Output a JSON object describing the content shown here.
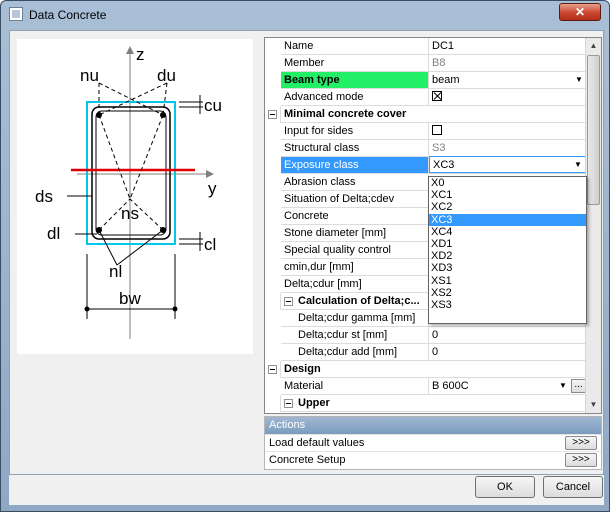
{
  "window": {
    "title": "Data Concrete",
    "close_label": "✕"
  },
  "diagram": {
    "labels": {
      "z": "z",
      "nu": "nu",
      "du": "du",
      "cu": "cu",
      "y": "y",
      "ds": "ds",
      "ns": "ns",
      "dl": "dl",
      "cl": "cl",
      "nl": "nl",
      "bw": "bw"
    },
    "colors": {
      "stirrup": "#00c8e8",
      "axis": "#808080",
      "neutral_line": "#e00000"
    }
  },
  "properties": [
    {
      "label": "Name",
      "value": "DC1",
      "kind": "text"
    },
    {
      "label": "Member",
      "value": "B8",
      "kind": "text",
      "gray": true
    },
    {
      "label": "Beam type",
      "value": "beam",
      "kind": "combo",
      "highlight": "#22ee66"
    },
    {
      "label": "Advanced mode",
      "value": "",
      "kind": "check",
      "checked": true
    },
    {
      "label": "Minimal concrete cover",
      "kind": "category",
      "level": 0
    },
    {
      "label": "Input for sides",
      "value": "",
      "kind": "check",
      "checked": false
    },
    {
      "label": "Structural class",
      "value": "S3",
      "kind": "text",
      "gray": true
    },
    {
      "label": "Exposure class",
      "value": "XC3",
      "kind": "combo",
      "selected": true
    },
    {
      "label": "Abrasion class",
      "value": "",
      "kind": "text"
    },
    {
      "label": "Situation of Delta;cdev",
      "value": "",
      "kind": "text"
    },
    {
      "label": "Concrete",
      "value": "",
      "kind": "text"
    },
    {
      "label": "Stone diameter [mm]",
      "value": "",
      "kind": "text"
    },
    {
      "label": "Special quality control",
      "value": "",
      "kind": "text"
    },
    {
      "label": "cmin,dur [mm]",
      "value": "",
      "kind": "text"
    },
    {
      "label": "Delta;cdur [mm]",
      "value": "",
      "kind": "text"
    },
    {
      "label": "Calculation of Delta;c...",
      "kind": "category",
      "level": 1
    },
    {
      "label": "Delta;cdur gamma [mm]",
      "value": "",
      "kind": "text",
      "level": 1
    },
    {
      "label": "Delta;cdur st [mm]",
      "value": "0",
      "kind": "text",
      "level": 1
    },
    {
      "label": "Delta;cdur add [mm]",
      "value": "0",
      "kind": "text",
      "level": 1
    },
    {
      "label": "Design",
      "kind": "category",
      "level": 0
    },
    {
      "label": "Material",
      "value": "B 600C",
      "kind": "combo-button",
      "button": "..."
    },
    {
      "label": "Upper",
      "kind": "category",
      "level": 1
    }
  ],
  "exposure_options": [
    "X0",
    "XC1",
    "XC2",
    "XC3",
    "XC4",
    "XD1",
    "XD2",
    "XD3",
    "XS1",
    "XS2",
    "XS3"
  ],
  "exposure_selected": "XC3",
  "actions": {
    "header": "Actions",
    "items": [
      {
        "label": "Load default values",
        "button": ">>>"
      },
      {
        "label": "Concrete Setup",
        "button": ">>>"
      }
    ]
  },
  "buttons": {
    "ok": "OK",
    "cancel": "Cancel"
  }
}
